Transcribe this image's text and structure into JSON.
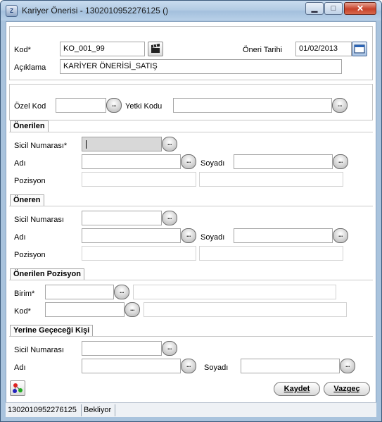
{
  "window": {
    "title": "Kariyer Önerisi - 1302010952276125 ()",
    "minimize": "▁",
    "maximize": "□",
    "close": "✕",
    "app_icon": "Z"
  },
  "header": {
    "kod_label": "Kod*",
    "kod_value": "KO_001_99",
    "tarih_label": "Öneri Tarihi",
    "tarih_value": "01/02/2013",
    "aciklama_label": "Açıklama",
    "aciklama_value": "KARİYER ÖNERİSİ_SATIŞ"
  },
  "codes": {
    "ozel_kod_label": "Özel Kod",
    "yetki_kodu_label": "Yetki Kodu"
  },
  "lookup_glyph": "...",
  "onerilen": {
    "title": "Önerilen",
    "sicil_label": "Sicil Numarası*",
    "adi_label": "Adı",
    "soyadi_label": "Soyadı",
    "pozisyon_label": "Pozisyon"
  },
  "oneren": {
    "title": "Öneren",
    "sicil_label": "Sicil Numarası",
    "adi_label": "Adı",
    "soyadi_label": "Soyadı",
    "pozisyon_label": "Pozisyon"
  },
  "onerilen_pozisyon": {
    "title": "Önerilen Pozisyon",
    "birim_label": "Birim*",
    "kod_label": "Kod*"
  },
  "yerine": {
    "title": "Yerine Geçeceği Kişi",
    "sicil_label": "Sicil Numarası",
    "adi_label": "Adı",
    "soyadi_label": "Soyadı"
  },
  "buttons": {
    "kaydet": "Kaydet",
    "vazgec": "Vazgeç"
  },
  "status": {
    "id": "1302010952276125",
    "state": "Bekliyor"
  },
  "icons": {
    "calendar": "calendar-icon",
    "clapper": "clapperboard-icon",
    "connect": "connection-nodes-icon"
  }
}
